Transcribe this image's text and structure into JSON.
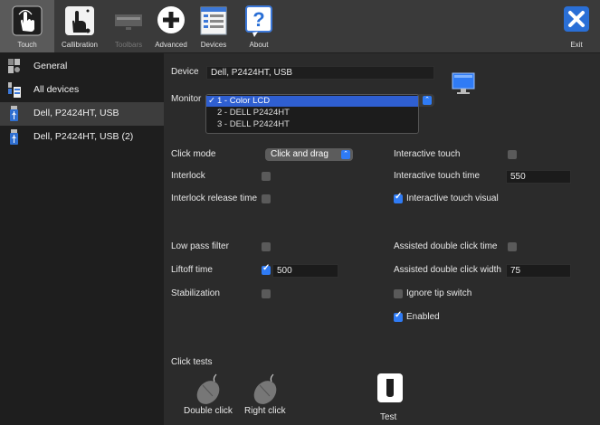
{
  "toolbar": {
    "items": [
      {
        "label": "Touch",
        "icon": "touch-hand-icon",
        "selected": true,
        "enabled": true
      },
      {
        "label": "Callibration",
        "icon": "calibration-icon",
        "selected": false,
        "enabled": true
      },
      {
        "label": "Toolbars",
        "icon": "toolbars-icon",
        "selected": false,
        "enabled": false
      },
      {
        "label": "Advanced",
        "icon": "plus-circle-icon",
        "selected": false,
        "enabled": true
      },
      {
        "label": "Devices",
        "icon": "devices-list-icon",
        "selected": false,
        "enabled": true
      },
      {
        "label": "About",
        "icon": "question-icon",
        "selected": false,
        "enabled": true
      }
    ],
    "exit_label": "Exit"
  },
  "sidebar": {
    "items": [
      {
        "label": "General",
        "icon": "general-settings-icon",
        "selected": false
      },
      {
        "label": "All devices",
        "icon": "all-devices-icon",
        "selected": false
      },
      {
        "label": "Dell, P2424HT, USB",
        "icon": "usb-device-icon",
        "selected": true
      },
      {
        "label": "Dell, P2424HT, USB (2)",
        "icon": "usb-device-icon",
        "selected": false
      }
    ]
  },
  "device": {
    "device_label": "Device",
    "device_value": "Dell, P2424HT, USB",
    "monitor_label": "Monitor",
    "monitor_options": [
      "1 - Color LCD",
      "2 - DELL P2424HT",
      "3 - DELL P2424HT"
    ],
    "monitor_selected": "1 - Color LCD",
    "monitor_icon": "monitor-icon"
  },
  "settings": {
    "click_mode_label": "Click mode",
    "click_mode_value": "Click and drag",
    "interlock_label": "Interlock",
    "interlock_release_label": "Interlock release time",
    "interactive_touch_label": "Interactive touch",
    "interactive_touch_time_label": "Interactive touch time",
    "interactive_touch_time_value": "550",
    "interactive_touch_visual_label": "Interactive touch visual",
    "low_pass_label": "Low pass filter",
    "liftoff_label": "Liftoff time",
    "liftoff_value": "500",
    "stabilization_label": "Stabilization",
    "assisted_dc_time_label": "Assisted double click time",
    "assisted_dc_width_label": "Assisted double click width",
    "assisted_dc_width_value": "75",
    "ignore_tip_label": "Ignore tip switch",
    "enabled_label": "Enabled"
  },
  "click_tests": {
    "title": "Click tests",
    "double_click_label": "Double click",
    "right_click_label": "Right click",
    "test_label": "Test"
  },
  "colors": {
    "accent": "#2f7bf5",
    "selection": "#2f5fd1",
    "exit": "#2a6fd6"
  }
}
